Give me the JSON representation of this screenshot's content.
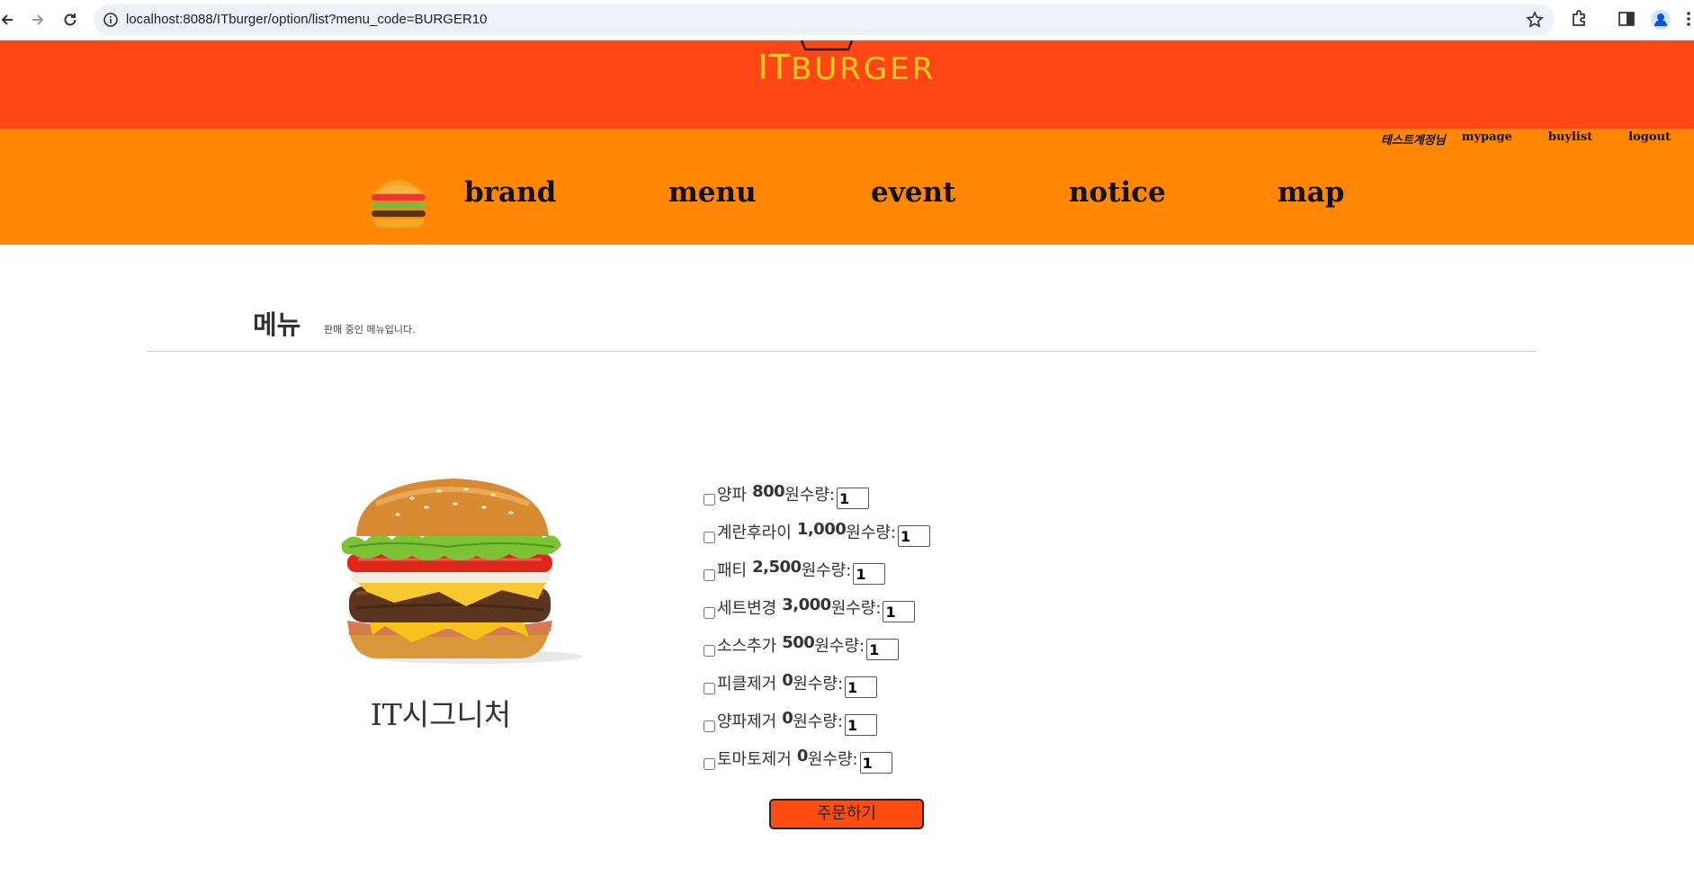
{
  "browser": {
    "url": "localhost:8088/ITburger/option/list?menu_code=BURGER10"
  },
  "header": {
    "logo_it": "IT",
    "logo_burger": "BURGER",
    "user_name": "테스트계정님",
    "mypage": "mypage",
    "buylist": "buylist",
    "logout": "logout",
    "nav": [
      "brand",
      "menu",
      "event",
      "notice",
      "map"
    ]
  },
  "page": {
    "title": "메뉴",
    "subtitle": "판매 중인 메뉴입니다."
  },
  "product": {
    "name": "IT시그니처"
  },
  "options": [
    {
      "name": "양파",
      "price": "800",
      "unit": "원",
      "qty_label": "수량:",
      "qty": "1"
    },
    {
      "name": "계란후라이",
      "price": "1,000",
      "unit": "원",
      "qty_label": "수량:",
      "qty": "1"
    },
    {
      "name": "패티",
      "price": "2,500",
      "unit": "원",
      "qty_label": "수량:",
      "qty": "1"
    },
    {
      "name": "세트변경",
      "price": "3,000",
      "unit": "원",
      "qty_label": "수량:",
      "qty": "1"
    },
    {
      "name": "소스추가",
      "price": "500",
      "unit": "원",
      "qty_label": "수량:",
      "qty": "1"
    },
    {
      "name": "피클제거",
      "price": "0",
      "unit": "원",
      "qty_label": "수량:",
      "qty": "1"
    },
    {
      "name": "양파제거",
      "price": "0",
      "unit": "원",
      "qty_label": "수량:",
      "qty": "1"
    },
    {
      "name": "토마토제거",
      "price": "0",
      "unit": "원",
      "qty_label": "수량:",
      "qty": "1"
    }
  ],
  "order_button": "주문하기",
  "colors": {
    "topbar": "#ff4615",
    "navbar": "#ff8704",
    "logo": "#ffd21e",
    "order_button": "#ff4c11"
  }
}
